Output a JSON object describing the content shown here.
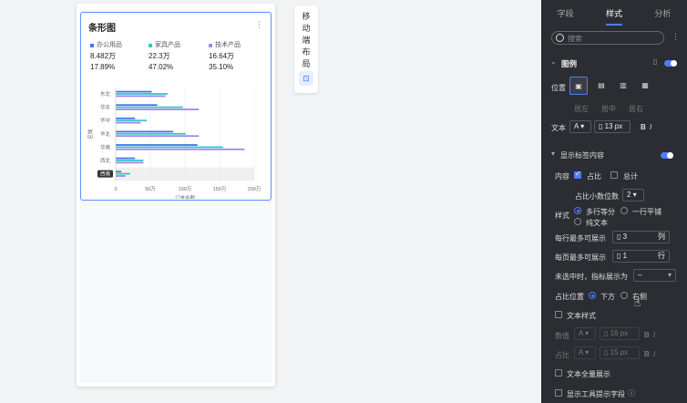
{
  "card": {
    "title": "条形图",
    "more": "⋮",
    "legend": [
      {
        "name": "办公用品",
        "value": "8.482万",
        "pct": "17.89%",
        "color": "#4a73e8"
      },
      {
        "name": "家具产品",
        "value": "22.3万",
        "pct": "47.02%",
        "color": "#38c6c6"
      },
      {
        "name": "技术产品",
        "value": "16.64万",
        "pct": "35.10%",
        "color": "#a387e8"
      }
    ]
  },
  "chart_data": {
    "type": "bar",
    "orientation": "horizontal",
    "categories": [
      "东北",
      "华东",
      "华中",
      "华北",
      "华南",
      "西北",
      "西南"
    ],
    "highlight_category": "西南",
    "series": [
      {
        "name": "办公用品",
        "values": [
          52,
          60,
          28,
          83,
          118,
          28,
          8
        ],
        "color": "#4a73e8"
      },
      {
        "name": "家具产品",
        "values": [
          75,
          97,
          45,
          101,
          155,
          40,
          21
        ],
        "color": "#38c6c6"
      },
      {
        "name": "技术产品",
        "values": [
          72,
          120,
          36,
          120,
          186,
          40,
          14
        ],
        "color": "#a387e8"
      }
    ],
    "xticks": [
      "0",
      "50万",
      "100万",
      "150万",
      "200万"
    ],
    "xlim": [
      0,
      200
    ],
    "xlabel": "订单金额",
    "ylabel": "区域"
  },
  "mobile_layout_tab": {
    "label": "移动端布局",
    "icon": "lock-icon"
  },
  "panel": {
    "tabs": [
      "字段",
      "样式",
      "分析"
    ],
    "active_tab": "样式",
    "search_placeholder": "搜索",
    "legend_section": "图例",
    "position_label": "位置",
    "position_sub": [
      "居左",
      "居中",
      "居右"
    ],
    "text_label": "文本",
    "text_font": "A",
    "text_size": "13",
    "text_unit": "px",
    "bold": "B",
    "italic": "I",
    "show_labels": "显示标签内容",
    "content_label": "内容",
    "opt_ratio": "占比",
    "opt_total": "总计",
    "decimals_label": "占比小数位数",
    "decimals_value": "2",
    "style_label": "样式",
    "style_opt1": "多行等分",
    "style_opt2": "一行平铺",
    "style_opt3": "纯文本",
    "max_row_label": "每行最多可展示",
    "max_row_value": "3",
    "max_row_unit": "列",
    "max_page_label": "每页最多可展示",
    "max_page_value": "1",
    "max_page_unit": "行",
    "unselected_label": "未选中时，指标展示为",
    "unselected_value": "–",
    "ratio_pos_label": "占比位置",
    "ratio_pos_opt1": "下方",
    "ratio_pos_opt2": "右侧",
    "text_style_label": "文本样式",
    "numeric_label": "数值",
    "numeric_size": "16",
    "ratio_label": "占比",
    "ratio_size": "15",
    "px": "px",
    "full_text_label": "文本全量展示",
    "tooltip_label": "显示工具提示字段"
  }
}
